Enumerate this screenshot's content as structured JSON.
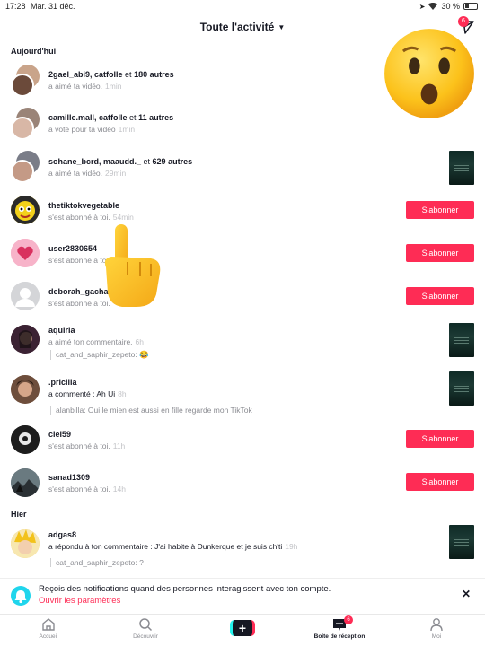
{
  "status_bar": {
    "time": "17:28",
    "date": "Mar. 31 déc.",
    "battery": "30 %"
  },
  "header": {
    "title": "Toute l'activité",
    "send_badge": "6"
  },
  "sections": {
    "today": "Aujourd'hui",
    "yesterday": "Hier"
  },
  "activities": [
    {
      "users": "2gael_abi9, catfolle",
      "connector": " et ",
      "count": "180 autres",
      "action": "a aimé ta vidéo.",
      "time": "1min",
      "trailing": "none"
    },
    {
      "users": "camille.mall, catfolle",
      "connector": " et ",
      "count": "11 autres",
      "action": "a voté pour ta vidéo",
      "time": "1min",
      "trailing": "thumbnail"
    },
    {
      "users": "sohane_bcrd, maaudd._",
      "connector": " et ",
      "count": "629 autres",
      "action": "a aimé ta vidéo.",
      "time": "29min",
      "trailing": "thumbnail"
    },
    {
      "users": "thetiktokvegetable",
      "action": "s'est abonné à toi.",
      "time": "54min",
      "trailing": "button",
      "button": "S'abonner"
    },
    {
      "users": "user2830654",
      "action": "s'est abonné à toi.",
      "time": "",
      "trailing": "button",
      "button": "S'abonner"
    },
    {
      "users": "deborah_gacha",
      "action": "s'est abonné à toi.",
      "time": "",
      "trailing": "button",
      "button": "S'abonner"
    },
    {
      "users": "aquiria",
      "action": "a aimé ton commentaire.",
      "time": "6h",
      "quote": "cat_and_saphir_zepeto: 😂",
      "trailing": "thumbnail"
    },
    {
      "users": ".pricilia",
      "action": "a commenté : Ah Ui",
      "time": "8h",
      "quote": "alanbilla: Oui le mien est aussi en fille regarde mon TikTok",
      "trailing": "thumbnail"
    },
    {
      "users": "ciel59",
      "action": "s'est abonné à toi.",
      "time": "11h",
      "trailing": "button",
      "button": "S'abonner"
    },
    {
      "users": "sanad1309",
      "action": "s'est abonné à toi.",
      "time": "14h",
      "trailing": "button",
      "button": "S'abonner"
    },
    {
      "users": "adgas8",
      "action": "a répondu à ton commentaire : J'ai habite à Dunkerque et je suis ch'ti",
      "time": "19h",
      "quote": "cat_and_saphir_zepeto: ?",
      "trailing": "thumbnail"
    }
  ],
  "notification": {
    "text": "Reçois des notifications quand des personnes interagissent avec ton compte.",
    "link": "Ouvrir les paramètres"
  },
  "tabbar": {
    "home": "Accueil",
    "discover": "Découvrir",
    "create": "+",
    "inbox": "Boîte de réception",
    "inbox_badge": "6",
    "me": "Moi"
  },
  "colors": {
    "accent": "#fe2c55",
    "cyan": "#20d5ec"
  }
}
